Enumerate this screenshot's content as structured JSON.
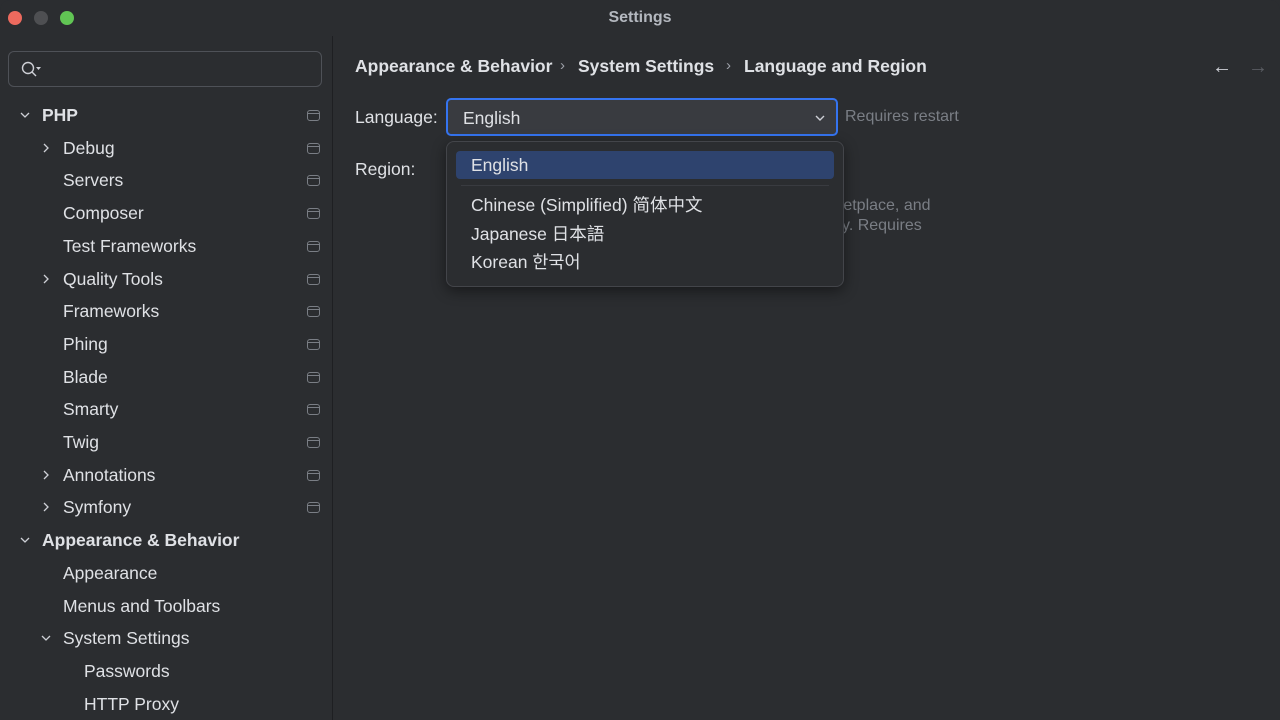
{
  "window": {
    "title": "Settings"
  },
  "sidebar": {
    "search": {
      "placeholder": "",
      "value": "",
      "icon": "search-icon"
    },
    "items": [
      {
        "label": "PHP",
        "level": 0,
        "bold": true,
        "expander": "expanded",
        "project_icon": true
      },
      {
        "label": "Debug",
        "level": 1,
        "expander": "collapsed",
        "project_icon": true
      },
      {
        "label": "Servers",
        "level": 1,
        "expander": "none",
        "project_icon": true
      },
      {
        "label": "Composer",
        "level": 1,
        "expander": "none",
        "project_icon": true
      },
      {
        "label": "Test Frameworks",
        "level": 1,
        "expander": "none",
        "project_icon": true
      },
      {
        "label": "Quality Tools",
        "level": 1,
        "expander": "collapsed",
        "project_icon": true
      },
      {
        "label": "Frameworks",
        "level": 1,
        "expander": "none",
        "project_icon": true
      },
      {
        "label": "Phing",
        "level": 1,
        "expander": "none",
        "project_icon": true
      },
      {
        "label": "Blade",
        "level": 1,
        "expander": "none",
        "project_icon": true
      },
      {
        "label": "Smarty",
        "level": 1,
        "expander": "none",
        "project_icon": true
      },
      {
        "label": "Twig",
        "level": 1,
        "expander": "none",
        "project_icon": true
      },
      {
        "label": "Annotations",
        "level": 1,
        "expander": "collapsed",
        "project_icon": true
      },
      {
        "label": "Symfony",
        "level": 1,
        "expander": "collapsed",
        "project_icon": true
      },
      {
        "label": "Appearance & Behavior",
        "level": 0,
        "bold": true,
        "expander": "expanded",
        "project_icon": false
      },
      {
        "label": "Appearance",
        "level": 1,
        "expander": "none",
        "project_icon": false
      },
      {
        "label": "Menus and Toolbars",
        "level": 1,
        "expander": "none",
        "project_icon": false
      },
      {
        "label": "System Settings",
        "level": 1,
        "expander": "expanded",
        "project_icon": false
      },
      {
        "label": "Passwords",
        "level": 2,
        "expander": "none",
        "project_icon": false
      },
      {
        "label": "HTTP Proxy",
        "level": 2,
        "expander": "none",
        "project_icon": false
      }
    ]
  },
  "main": {
    "breadcrumb": [
      "Appearance & Behavior",
      "System Settings",
      "Language and Region"
    ],
    "breadcrumb_separator": "›",
    "nav": {
      "back": "←",
      "forward": "→"
    },
    "language": {
      "label": "Language:",
      "value": "English",
      "hint": "Requires restart",
      "options": [
        "English",
        "Chinese (Simplified) 简体中文",
        "Japanese 日本語",
        "Korean 한국어"
      ],
      "selected_index": 0
    },
    "region": {
      "label": "Region:",
      "description_visible": [
        "rketplace, and",
        "y. Requires"
      ]
    }
  },
  "colors": {
    "accent": "#3574f0",
    "selection": "#2e436e",
    "background": "#2b2d30",
    "text": "#dfe1e5",
    "muted": "#7a7e85"
  }
}
